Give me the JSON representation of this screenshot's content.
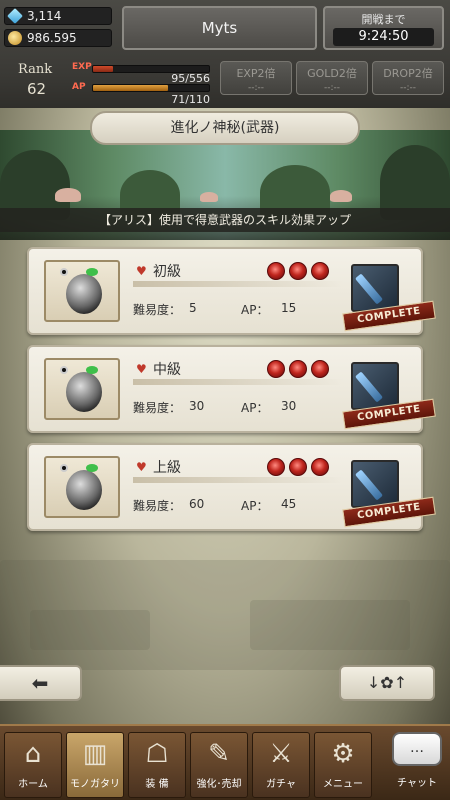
{
  "hud": {
    "crystals": "3,114",
    "gold": "986.595",
    "player_name": "Myts",
    "battle_label": "開戦まで",
    "battle_timer": "9:24:50",
    "rank_label": "Rank",
    "rank_value": "62",
    "exp_label": "EXP",
    "exp_text": "95/556",
    "exp_fraction": 0.17,
    "ap_label": "AP",
    "ap_text": "71/110",
    "ap_fraction": 0.645,
    "boosts": [
      {
        "title": "EXP2倍",
        "sub": "--:--"
      },
      {
        "title": "GOLD2倍",
        "sub": "--:--"
      },
      {
        "title": "DROP2倍",
        "sub": "--:--"
      }
    ]
  },
  "page_title": "進化ノ神秘(武器)",
  "banner_caption": "【アリス】使用で得意武器のスキル効果アップ",
  "quests": [
    {
      "name": "初級",
      "difficulty_label": "難易度：",
      "difficulty": "5",
      "ap_label": "AP：",
      "ap": "15",
      "badge": "COMPLETE"
    },
    {
      "name": "中級",
      "difficulty_label": "難易度：",
      "difficulty": "30",
      "ap_label": "AP：",
      "ap": "30",
      "badge": "COMPLETE"
    },
    {
      "name": "上級",
      "difficulty_label": "難易度：",
      "difficulty": "60",
      "ap_label": "AP：",
      "ap": "45",
      "badge": "COMPLETE"
    }
  ],
  "nav": [
    {
      "label": "ホーム",
      "icon": "castle-icon",
      "glyph": "⌂"
    },
    {
      "label": "モノガタリ",
      "icon": "book-icon",
      "glyph": "▥"
    },
    {
      "label": "装 備",
      "icon": "equipment-icon",
      "glyph": "☖"
    },
    {
      "label": "強化･売却",
      "icon": "enhance-icon",
      "glyph": "✎"
    },
    {
      "label": "ガチャ",
      "icon": "crossed-swords-icon",
      "glyph": "⚔"
    },
    {
      "label": "メニュー",
      "icon": "gears-icon",
      "glyph": "⚙"
    }
  ],
  "chat": {
    "label": "チャット",
    "glyph": "…"
  },
  "colors": {
    "accent_red": "#c0392b",
    "complete_badge": "#8e2a1a",
    "nav_wood": "#6a4a2e"
  }
}
